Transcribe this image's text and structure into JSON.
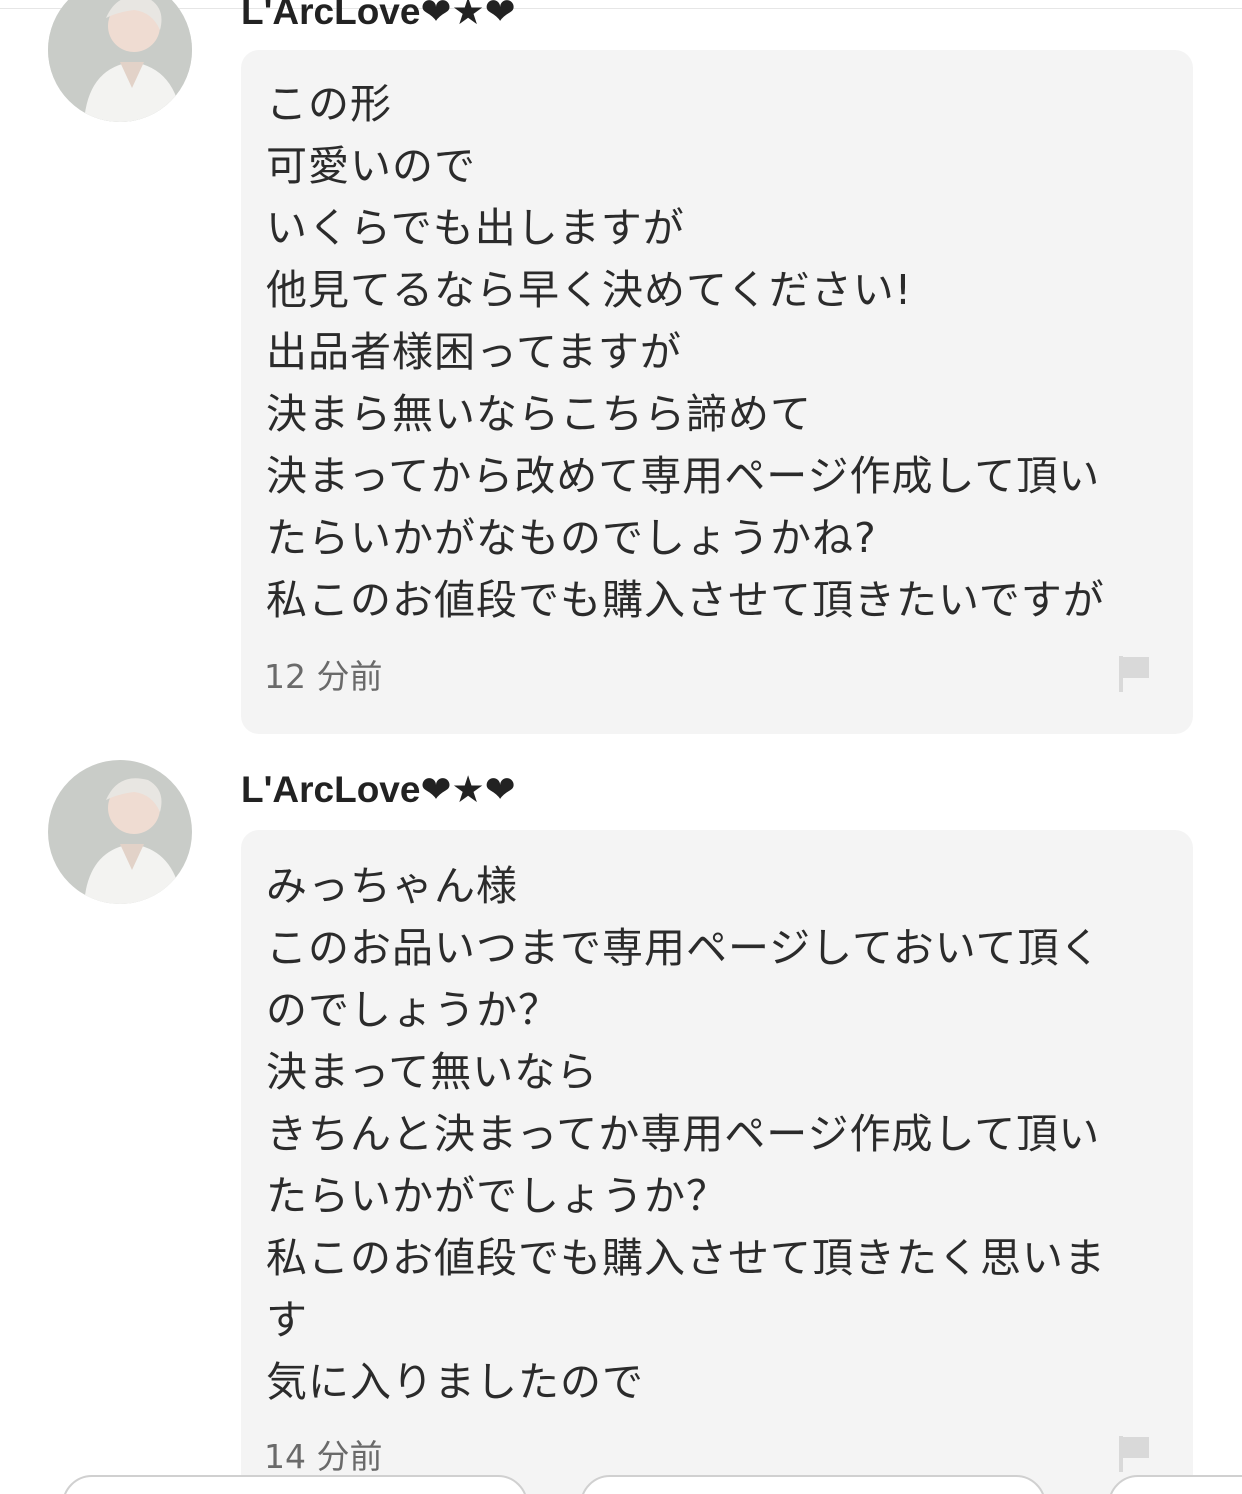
{
  "comments": [
    {
      "username": "L'ArcLove❤★❤",
      "lines": [
        "この形",
        "可愛いので",
        "いくらでも出しますが",
        "他見てるなら早く決めてください!",
        "出品者様困ってますが",
        "決まら無いならこちら諦めて",
        "決まってから改めて専用ページ作成して頂い",
        "たらいかがなものでしょうかね?",
        "私このお値段でも購入させて頂きたいですが"
      ],
      "time": "12 分前",
      "report_icon": "flag-icon"
    },
    {
      "username": "L'ArcLove❤★❤",
      "lines": [
        "みっちゃん様",
        "このお品いつまで専用ページしておいて頂く",
        "のでしょうか？",
        "決まって無いなら",
        "きちんと決まってか専用ページ作成して頂い",
        "たらいかがでしょうか？",
        "私このお値段でも購入させて頂きたく思いま",
        "す",
        "気に入りましたので"
      ],
      "time": "14 分前",
      "report_icon": "flag-icon"
    }
  ],
  "colors": {
    "bubble_bg": "#f4f4f4",
    "text": "#2b2b2b",
    "timestamp": "#6a6a6a",
    "flag": "#d9d9d9"
  }
}
